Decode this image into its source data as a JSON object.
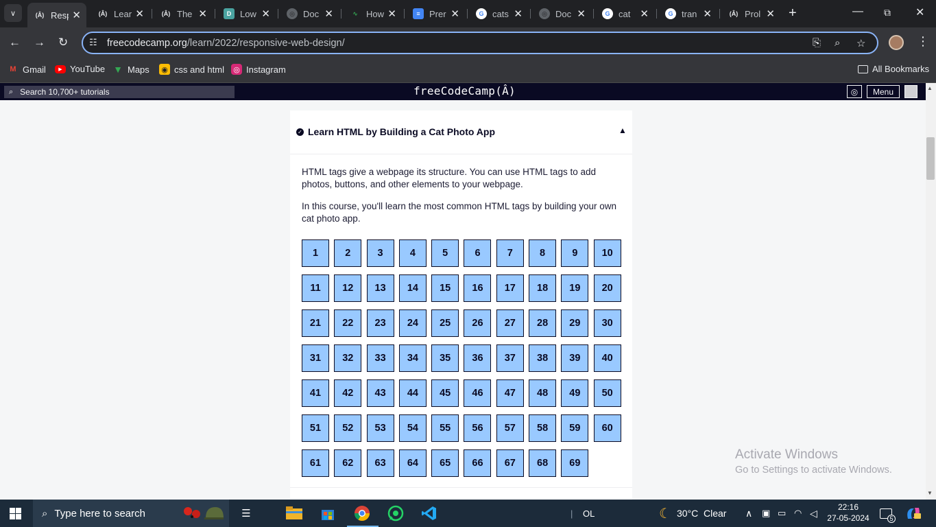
{
  "browser": {
    "tabs": [
      {
        "title": "Resp",
        "icon": "freecodecamp-icon",
        "active": true
      },
      {
        "title": "Lear",
        "icon": "freecodecamp-icon"
      },
      {
        "title": "The",
        "icon": "freecodecamp-icon"
      },
      {
        "title": "Low",
        "icon": "d-icon"
      },
      {
        "title": "Doc",
        "icon": "globe-icon"
      },
      {
        "title": "How",
        "icon": "ae-icon"
      },
      {
        "title": "Prer",
        "icon": "docs-icon"
      },
      {
        "title": "cats",
        "icon": "google-icon"
      },
      {
        "title": "Doc",
        "icon": "globe-icon"
      },
      {
        "title": "cat",
        "icon": "google-icon"
      },
      {
        "title": "tran",
        "icon": "google-icon"
      },
      {
        "title": "Prol",
        "icon": "freecodecamp-icon"
      }
    ],
    "url_host": "freecodecamp.org",
    "url_path": "/learn/2022/responsive-web-design/",
    "bookmarks": [
      {
        "label": "Gmail",
        "icon": "gmail-icon"
      },
      {
        "label": "YouTube",
        "icon": "youtube-icon"
      },
      {
        "label": "Maps",
        "icon": "maps-icon"
      },
      {
        "label": "css and html",
        "icon": "bookmark-icon"
      },
      {
        "label": "Instagram",
        "icon": "instagram-icon"
      }
    ],
    "all_bookmarks": "All Bookmarks"
  },
  "fcc_nav": {
    "search_placeholder": "Search 10,700+ tutorials",
    "logo": "freeCodeCamp(Â)",
    "menu_label": "Menu"
  },
  "block": {
    "title": "Learn HTML by Building a Cat Photo App",
    "description_1": "HTML tags give a webpage its structure. You can use HTML tags to add photos, buttons, and other elements to your webpage.",
    "description_2": "In this course, you'll learn the most common HTML tags by building your own cat photo app.",
    "steps": [
      "1",
      "2",
      "3",
      "4",
      "5",
      "6",
      "7",
      "8",
      "9",
      "10",
      "11",
      "12",
      "13",
      "14",
      "15",
      "16",
      "17",
      "18",
      "19",
      "20",
      "21",
      "22",
      "23",
      "24",
      "25",
      "26",
      "27",
      "28",
      "29",
      "30",
      "31",
      "32",
      "33",
      "34",
      "35",
      "36",
      "37",
      "38",
      "39",
      "40",
      "41",
      "42",
      "43",
      "44",
      "45",
      "46",
      "47",
      "48",
      "49",
      "50",
      "51",
      "52",
      "53",
      "54",
      "55",
      "56",
      "57",
      "58",
      "59",
      "60",
      "61",
      "62",
      "63",
      "64",
      "65",
      "66",
      "67",
      "68",
      "69"
    ]
  },
  "watermark": {
    "line1": "Activate Windows",
    "line2": "Go to Settings to activate Windows."
  },
  "taskbar": {
    "search_placeholder": "Type here to search",
    "language": "OL",
    "weather": "30°C  Clear",
    "time": "22:16",
    "date": "27-05-2024",
    "notification_count": "5"
  },
  "colors": {
    "fcc_dark": "#0a0a23",
    "step_fill": "#99c9ff",
    "omnibox_focus": "#8ab4f8",
    "taskbar": "#1c2b3a"
  }
}
